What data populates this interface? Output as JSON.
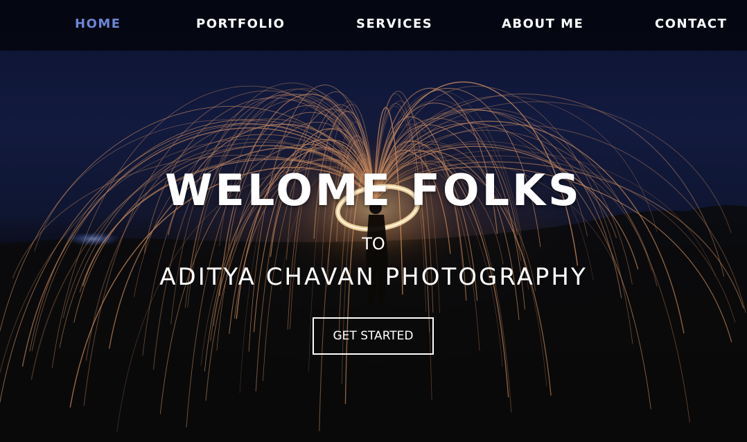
{
  "nav": {
    "items": [
      {
        "label": "HOME",
        "active": true
      },
      {
        "label": "PORTFOLIO",
        "active": false
      },
      {
        "label": "SERVICES",
        "active": false
      },
      {
        "label": "ABOUT ME",
        "active": false
      },
      {
        "label": "CONTACT",
        "active": false
      }
    ]
  },
  "hero": {
    "title": "WELOME FOLKS",
    "to_text": "TO",
    "subtitle": "ADITYA CHAVAN PHOTOGRAPHY",
    "cta_label": "GET STARTED"
  },
  "colors": {
    "nav_background": "#05070f",
    "nav_active": "#6b86d6",
    "text": "#ffffff",
    "spark": "#f2a56a"
  }
}
